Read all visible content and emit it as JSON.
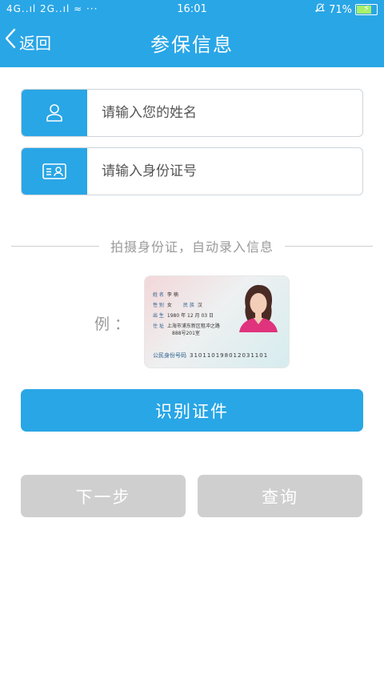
{
  "status_bar": {
    "signal": "4G..ıl 2G..ıl ≈ ···",
    "time": "16:01",
    "alarm_icon": "bell-off-icon",
    "battery": "71%"
  },
  "nav": {
    "back_label": "返回",
    "title": "参保信息"
  },
  "form": {
    "name_placeholder": "请输入您的姓名",
    "id_placeholder": "请输入身份证号",
    "name_icon": "user-icon",
    "id_icon": "id-card-icon"
  },
  "divider_text": "拍摄身份证，自动录入信息",
  "example": {
    "label": "例：",
    "card": {
      "name_label": "姓 名",
      "name": "李 楠",
      "sex_label": "性 别",
      "sex": "女",
      "nation_label": "民 族",
      "nation": "汉",
      "birth_label": "出 生",
      "birth": "1980  年 12 月 03 日",
      "address_label": "住 址",
      "address_line1": "上海市浦东新区租冲之路",
      "address_line2": "888号201室",
      "id_label": "公民身份号码",
      "id_number": "310110198012031101"
    }
  },
  "buttons": {
    "recognize": "识别证件",
    "next": "下一步",
    "query": "查询"
  },
  "colors": {
    "primary": "#29a6e6",
    "disabled": "#cfcfcf"
  }
}
